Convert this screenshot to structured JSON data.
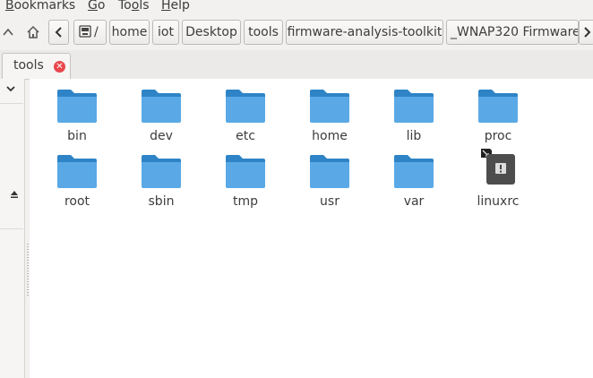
{
  "menubar": {
    "items": [
      {
        "label": "Bookmarks",
        "u": "B",
        "rest": "ookmarks"
      },
      {
        "label": "Go",
        "u": "G",
        "rest": "o"
      },
      {
        "label": "Tools",
        "pre": "To",
        "u": "o",
        "rest": "ls"
      },
      {
        "label": "Help",
        "u": "H",
        "rest": "elp"
      }
    ]
  },
  "pathbar": {
    "up_icon": "chevron-up-icon",
    "home_icon": "home-icon",
    "back_icon": "chevron-left-icon",
    "drive_icon": "drive-icon",
    "root_label": "/",
    "crumbs": [
      "home",
      "iot",
      "Desktop",
      "tools",
      "firmware-analysis-toolkit",
      "_WNAP320 Firmware"
    ],
    "forward_icon": "chevron-right-icon"
  },
  "tabs": [
    {
      "label": "tools",
      "close_icon": "close-icon"
    }
  ],
  "sidebar": {
    "collapse_icon": "chevron-down-icon",
    "eject_icon": "eject-icon"
  },
  "files": [
    {
      "name": "bin",
      "type": "folder"
    },
    {
      "name": "dev",
      "type": "folder"
    },
    {
      "name": "etc",
      "type": "folder"
    },
    {
      "name": "home",
      "type": "folder"
    },
    {
      "name": "lib",
      "type": "folder"
    },
    {
      "name": "proc",
      "type": "folder"
    },
    {
      "name": "root",
      "type": "folder"
    },
    {
      "name": "sbin",
      "type": "folder"
    },
    {
      "name": "tmp",
      "type": "folder"
    },
    {
      "name": "usr",
      "type": "folder"
    },
    {
      "name": "var",
      "type": "folder"
    },
    {
      "name": "linuxrc",
      "type": "symlink-executable"
    }
  ],
  "colors": {
    "folder": "#5aa9e6",
    "folder_tab": "#2e84c6",
    "file_icon": "#4d4d4d"
  }
}
